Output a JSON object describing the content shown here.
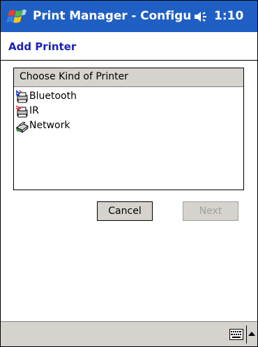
{
  "taskbar": {
    "title": "Print Manager - Configu",
    "clock": "1:10",
    "start_icon": "windows-flag-icon",
    "volume_icon": "speaker-icon"
  },
  "page": {
    "title": "Add Printer"
  },
  "printer_list": {
    "header": "Choose Kind of Printer",
    "items": [
      {
        "label": "Bluetooth",
        "icon": "bluetooth-printer-icon"
      },
      {
        "label": "IR",
        "icon": "ir-printer-icon"
      },
      {
        "label": "Network",
        "icon": "network-printer-icon"
      }
    ]
  },
  "buttons": {
    "cancel": "Cancel",
    "next": "Next"
  },
  "menubar": {
    "keyboard_icon": "keyboard-icon",
    "sip_arrow_icon": "up-arrow-icon"
  },
  "colors": {
    "titlebar": "#1f5fc4",
    "subheader_text": "#1a22b8",
    "chrome_gray": "#d6d3ce"
  }
}
